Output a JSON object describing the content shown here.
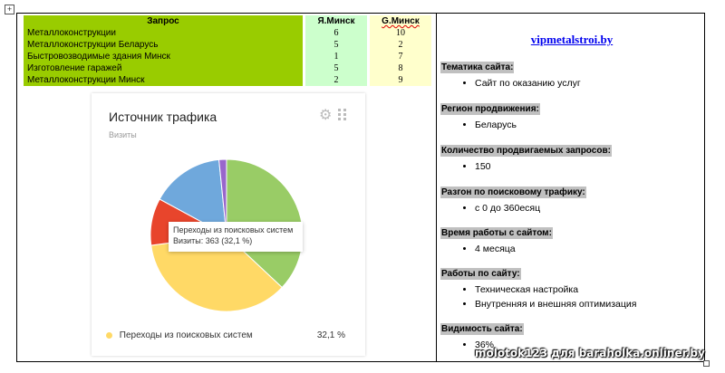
{
  "table": {
    "headers": [
      "Запрос",
      "Я.Минск",
      "G.Минск"
    ],
    "rows": [
      {
        "query": "Металлоконструкции",
        "yandex": "6",
        "google": "10"
      },
      {
        "query": "Металлоконструкции Беларусь",
        "yandex": "5",
        "google": "2"
      },
      {
        "query": "Быстровозводимые здания Минск",
        "yandex": "1",
        "google": "7"
      },
      {
        "query": "Изготовление гаражей",
        "yandex": "5",
        "google": "8"
      },
      {
        "query": "Металлоконструкции Минск",
        "yandex": "2",
        "google": "9"
      }
    ]
  },
  "widget": {
    "title": "Источник трафика",
    "subtitle": "Визиты",
    "tooltip_line1": "Переходы из поисковых систем",
    "tooltip_line2": "Визиты: 363 (32,1 %)",
    "legend_label": "Переходы из поисковых систем",
    "legend_value": "32,1 %",
    "icons": [
      "gear-icon",
      "drag-grid-icon"
    ]
  },
  "chart_data": {
    "type": "pie",
    "categories": [
      "green",
      "yellow",
      "red",
      "blue",
      "purple"
    ],
    "values": [
      37,
      35.9,
      10,
      15.5,
      1.6
    ],
    "colors": [
      "#99cc66",
      "#ffd966",
      "#e8452c",
      "#6fa8dc",
      "#9966cc"
    ]
  },
  "right": {
    "site": "vipmetalstroi.by",
    "sections": [
      {
        "heading": "Тематика сайта:",
        "items": [
          "Сайт по оказанию услуг"
        ]
      },
      {
        "heading": "Регион продвижения:",
        "items": [
          "Беларусь"
        ]
      },
      {
        "heading": "Количество продвигаемых запросов:",
        "items": [
          "150"
        ]
      },
      {
        "heading": "Разгон по поисковому трафику:",
        "items": [
          "с 0 до 360есяц"
        ]
      },
      {
        "heading": "Время работы с сайтом:",
        "items": [
          "4 месяца"
        ]
      },
      {
        "heading": "Работы по сайту:",
        "items": [
          "Техническая настройка",
          "Внутренняя и внешняя оптимизация"
        ]
      },
      {
        "heading": "Видимость сайта:",
        "items": [
          "36%"
        ]
      }
    ]
  },
  "watermark": "molotok123 для baraholka.onliner.by",
  "colors": {
    "query_bg": "#99cc00",
    "yandex_bg": "#ccffcc",
    "google_bg": "#ffffcc",
    "link": "#0000ee"
  }
}
